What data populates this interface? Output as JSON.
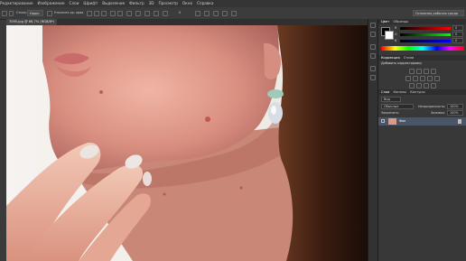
{
  "menu": [
    "Редактирование",
    "Изображение",
    "Слои",
    "Шрифт",
    "Выделение",
    "Фильтр",
    "3D",
    "Просмотр",
    "Окно",
    "Справка"
  ],
  "options": {
    "mode_label": "Стиль:",
    "mode_value": "Норм.",
    "refine_label": "Уточнить кр",
    "edge_label": "Уточнить кр. края",
    "angle": "90",
    "size": "0",
    "workspace": "Основная рабочая среда"
  },
  "document": {
    "tab_title": "7095.jpg @ 66,7% (RGB/8*)"
  },
  "panels": {
    "color_tabs": [
      "Цвет",
      "Образцы"
    ],
    "color_channels": [
      {
        "label": "R",
        "value": "0"
      },
      {
        "label": "G",
        "value": "0"
      },
      {
        "label": "B",
        "value": "0"
      }
    ],
    "adjust_tabs": [
      "Коррекция",
      "Стили"
    ],
    "adjust_title": "Добавить корректировку",
    "layers_tabs": [
      "Слои",
      "Каналы",
      "Контуры"
    ],
    "layers_filter": "Вид",
    "blend_mode": "Обычные",
    "opacity_label": "Непрозрачность:",
    "opacity_value": "100%",
    "lock_label": "Закрепить:",
    "fill_label": "Заливка:",
    "fill_value": "100%",
    "layer_name": "Фон"
  },
  "colors": {
    "accent": "#4a8ad8",
    "panel_bg": "#383838",
    "canvas_bg": "#262626"
  }
}
